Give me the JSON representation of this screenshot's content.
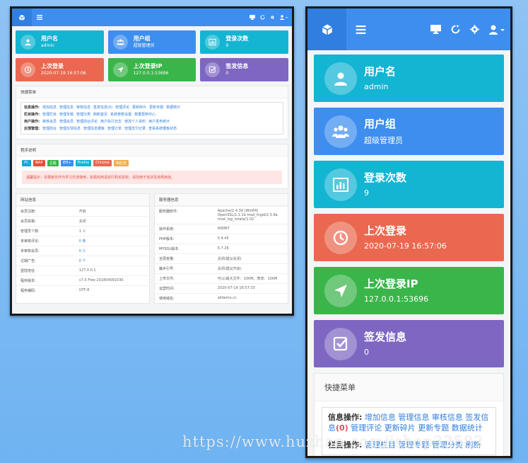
{
  "cards": [
    {
      "title": "用户名",
      "value": "admin",
      "icon": "user-icon",
      "color": "#13b5d3"
    },
    {
      "title": "用户组",
      "value": "超级管理员",
      "icon": "users-icon",
      "color": "#3d8eef"
    },
    {
      "title": "登录次数",
      "value": "9",
      "icon": "chart-icon",
      "color": "#13b5d3"
    },
    {
      "title": "上次登录",
      "value": "2020-07-19 16:57:06",
      "icon": "clock-icon",
      "color": "#ea6850"
    },
    {
      "title": "上次登录IP",
      "value": "127.0.0.1:53696",
      "icon": "location-arrow-icon",
      "color": "#3ab54a"
    },
    {
      "title": "签发信息",
      "value": "0",
      "icon": "check-square-icon",
      "color": "#7e67c2"
    }
  ],
  "quick_menu": {
    "title": "快捷菜单",
    "rows": [
      {
        "label": "信息操作:",
        "items": [
          "增加信息",
          "管理信息",
          "审核信息",
          "签发信息(0)",
          "管理评论",
          "更新碎片",
          "更新专题",
          "数据统计"
        ]
      },
      {
        "label": "栏目操作:",
        "items": [
          "管理栏目",
          "管理专题",
          "管理分类",
          "刷新首页",
          "系统参数设置",
          "数据更新中心"
        ]
      },
      {
        "label": "用户操作:",
        "items": [
          "审核会员",
          "管理会员",
          "管理前台评论",
          "用户执行日志",
          "修改个人资料",
          "用户发布统计"
        ]
      },
      {
        "label": "反馈管理:",
        "items": [
          "管理前台",
          "管理反馈信息",
          "管理信息模板",
          "管理订单",
          "管理支付记录",
          "查看系统模板状态"
        ]
      }
    ],
    "mobile_row1_label": "信息操作:",
    "mobile_row1_items": [
      "增加信息",
      "管理信息",
      "审核信息",
      "签发信息"
    ],
    "mobile_row1_count": "(0)",
    "mobile_row1_items2": [
      "管理评论",
      "更新碎片",
      "更新专题",
      "数据统计"
    ],
    "mobile_row2_label": "栏目操作:",
    "mobile_row2_items": [
      "管理栏目",
      "管理专题",
      "管理分类",
      "刷新"
    ]
  },
  "program": {
    "title": "程序说明",
    "badges": [
      {
        "text": "PC",
        "color": "#1aa3d9"
      },
      {
        "text": "WAP",
        "color": "#e0533b"
      },
      {
        "text": "主题",
        "color": "#3ab54a"
      },
      {
        "text": "IE8+",
        "color": "#3d8eef"
      },
      {
        "text": "Firefox",
        "color": "#13b5d3"
      },
      {
        "text": "Chrome",
        "color": "#ea6850"
      },
      {
        "text": "响应式",
        "color": "#f0ad4e"
      }
    ],
    "warning": "温馨提示：本模板仅作为学习交流使用，如需商用请自行购买授权，请勿用于违法及违规用途。"
  },
  "site_info": {
    "title": "网站信息",
    "rows": [
      {
        "k": "会员注册:",
        "v": "开启"
      },
      {
        "k": "会员投稿:",
        "v": "关闭"
      },
      {
        "k": "管理员个数:",
        "v": "1 人"
      },
      {
        "k": "未审核评论:",
        "v": "0 条"
      },
      {
        "k": "未审核会员:",
        "v": "0 人"
      },
      {
        "k": "过期广告:",
        "v": "0 个"
      },
      {
        "k": "登陆地址:",
        "v": "127.0.0.1"
      },
      {
        "k": "程序版本:",
        "v": "v7.5 Free 201804091030"
      },
      {
        "k": "程序编码:",
        "v": "UTF-8"
      }
    ]
  },
  "server_info": {
    "title": "服务器信息",
    "rows": [
      {
        "k": "服务器软件:",
        "v": "Apache/2.4.39 (Win64) OpenSSL/1.1.1b mod_fcgid/2.3.9a mod_log_rotate/1.02"
      },
      {
        "k": "操作系统:",
        "v": "WINNT"
      },
      {
        "k": "PHP版本:",
        "v": "5.4.45"
      },
      {
        "k": "MYSQL版本:",
        "v": "5.7.26"
      },
      {
        "k": "全局变量:",
        "v": "关闭(建议关闭)"
      },
      {
        "k": "魔术引号:",
        "v": "关闭(建议开启)"
      },
      {
        "k": "上传文件:",
        "v": "可以(最大文件：100M，表单：100M"
      },
      {
        "k": "运营时间:",
        "v": "2020-07-19 16:57:33"
      },
      {
        "k": "使用域名:",
        "v": "alldemo.cc"
      }
    ]
  },
  "watermark": "https://www.huzhan.com/ishop33582"
}
